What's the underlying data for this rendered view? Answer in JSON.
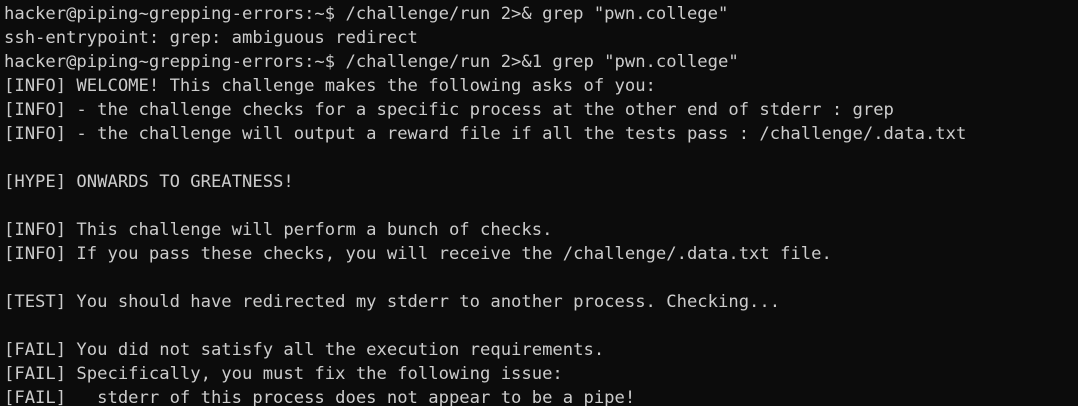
{
  "terminal": {
    "lines": [
      "hacker@piping~grepping-errors:~$ /challenge/run 2>& grep \"pwn.college\"",
      "ssh-entrypoint: grep: ambiguous redirect",
      "hacker@piping~grepping-errors:~$ /challenge/run 2>&1 grep \"pwn.college\"",
      "[INFO] WELCOME! This challenge makes the following asks of you:",
      "[INFO] - the challenge checks for a specific process at the other end of stderr : grep",
      "[INFO] - the challenge will output a reward file if all the tests pass : /challenge/.data.txt",
      "",
      "[HYPE] ONWARDS TO GREATNESS!",
      "",
      "[INFO] This challenge will perform a bunch of checks.",
      "[INFO] If you pass these checks, you will receive the /challenge/.data.txt file.",
      "",
      "[TEST] You should have redirected my stderr to another process. Checking...",
      "",
      "[FAIL] You did not satisfy all the execution requirements.",
      "[FAIL] Specifically, you must fix the following issue:",
      "[FAIL]   stderr of this process does not appear to be a pipe!"
    ]
  },
  "colors": {
    "background": "#0c0c0c",
    "foreground": "#cccccc"
  }
}
